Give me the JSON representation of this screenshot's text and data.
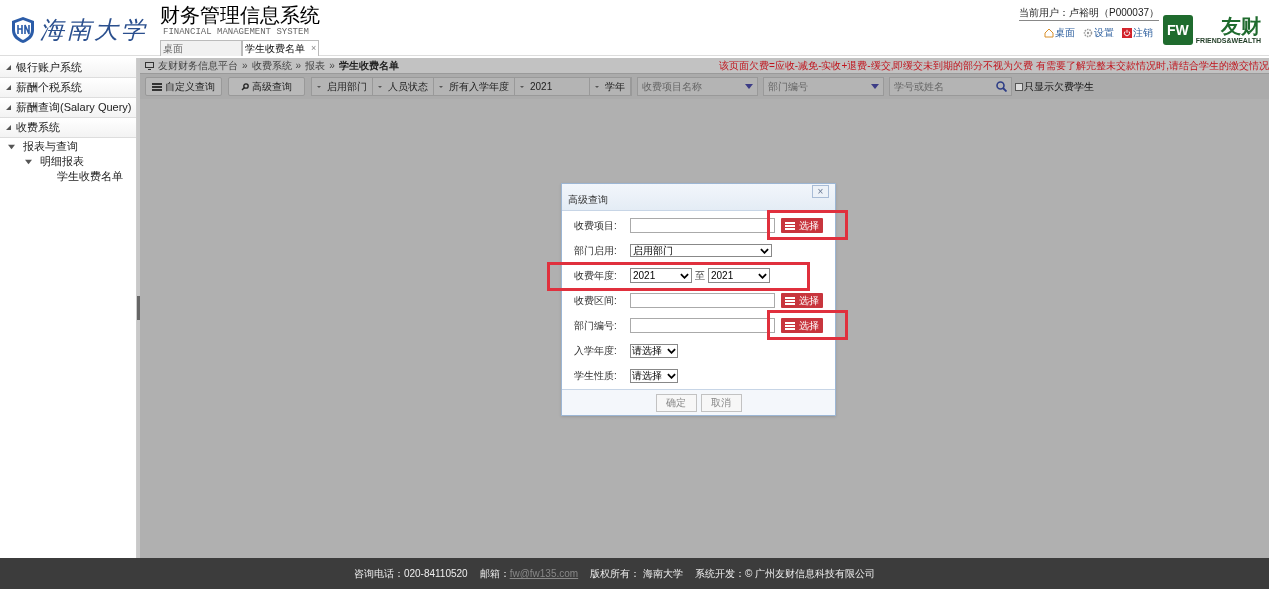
{
  "header": {
    "university": "海南大学",
    "title": "财务管理信息系统",
    "subtitle": "FINANCIAL MANAGEMENT SYSTEM",
    "tabs": [
      {
        "label": "桌面",
        "selected": false
      },
      {
        "label": "学生收费名单",
        "selected": true,
        "close": "×"
      }
    ],
    "user": "当前用户：卢裕明（P000037）",
    "links": [
      {
        "kind": "home",
        "label": "桌面"
      },
      {
        "kind": "settings",
        "label": "设置"
      },
      {
        "kind": "logout",
        "label": "注销"
      }
    ],
    "brand": {
      "mark": "FW",
      "name": "友财",
      "tagline": "FRIENDS&WEALTH"
    }
  },
  "sidebar": {
    "sections": [
      {
        "label": "银行账户系统"
      },
      {
        "label": "薪酬个税系统"
      },
      {
        "label": "薪酬查询(Salary Query)"
      },
      {
        "label": "收费系统"
      }
    ],
    "tree": [
      {
        "label": "报表与查询",
        "expanded": true,
        "children": [
          {
            "label": "明细报表",
            "expanded": true,
            "children": [
              {
                "label": "学生收费名单"
              }
            ]
          }
        ]
      }
    ]
  },
  "breadcrumb": {
    "separator": "»",
    "items": [
      "友财财务信息平台",
      "收费系统",
      "报表",
      "学生收费名单"
    ]
  },
  "notice": "该页面欠费=应收-减免-实收+退费-缓交,即缓交未到期的部分不视为欠费 有需要了解完整未交款情况时,请结合学生的缴交情况",
  "toolbar": {
    "buttons": [
      {
        "kind": "list",
        "label": "自定义查询"
      },
      {
        "kind": "search",
        "label": "高级查询"
      }
    ],
    "filters": [
      "启用部门",
      "人员状态",
      "所有入学年度",
      "2021",
      "学年"
    ],
    "selects": [
      {
        "placeholder": "收费项目名称"
      },
      {
        "placeholder": "部门编号"
      }
    ],
    "search": {
      "placeholder": "学号或姓名"
    },
    "checkbox": {
      "label": "只显示欠费学生",
      "checked": false
    }
  },
  "dialog": {
    "title": "高级查询",
    "close": "×",
    "fields": [
      {
        "kind": "picker",
        "label": "收费项目:",
        "button": "选择",
        "highlighted": true
      },
      {
        "kind": "select",
        "label": "部门启用:",
        "value": "启用部门",
        "highlighted": false
      },
      {
        "kind": "range",
        "label": "收费年度:",
        "from": "2021",
        "separator": "至",
        "to": "2021",
        "highlighted": true
      },
      {
        "kind": "picker",
        "label": "收费区间:",
        "button": "选择",
        "highlighted": false
      },
      {
        "kind": "picker",
        "label": "部门编号:",
        "button": "选择",
        "highlighted": true
      },
      {
        "kind": "small-select",
        "label": "入学年度:",
        "value": "请选择",
        "highlighted": false
      },
      {
        "kind": "small-select",
        "label": "学生性质:",
        "value": "请选择",
        "highlighted": false
      }
    ],
    "buttons": [
      "确定",
      "取消"
    ]
  },
  "footer": {
    "phone": "咨询电话：020-84110520",
    "email_label": "邮箱：",
    "email": "fw@fw135.com",
    "copyright": "版权所有： 海南大学",
    "developer": "系统开发：© 广州友财信息科技有限公司"
  }
}
